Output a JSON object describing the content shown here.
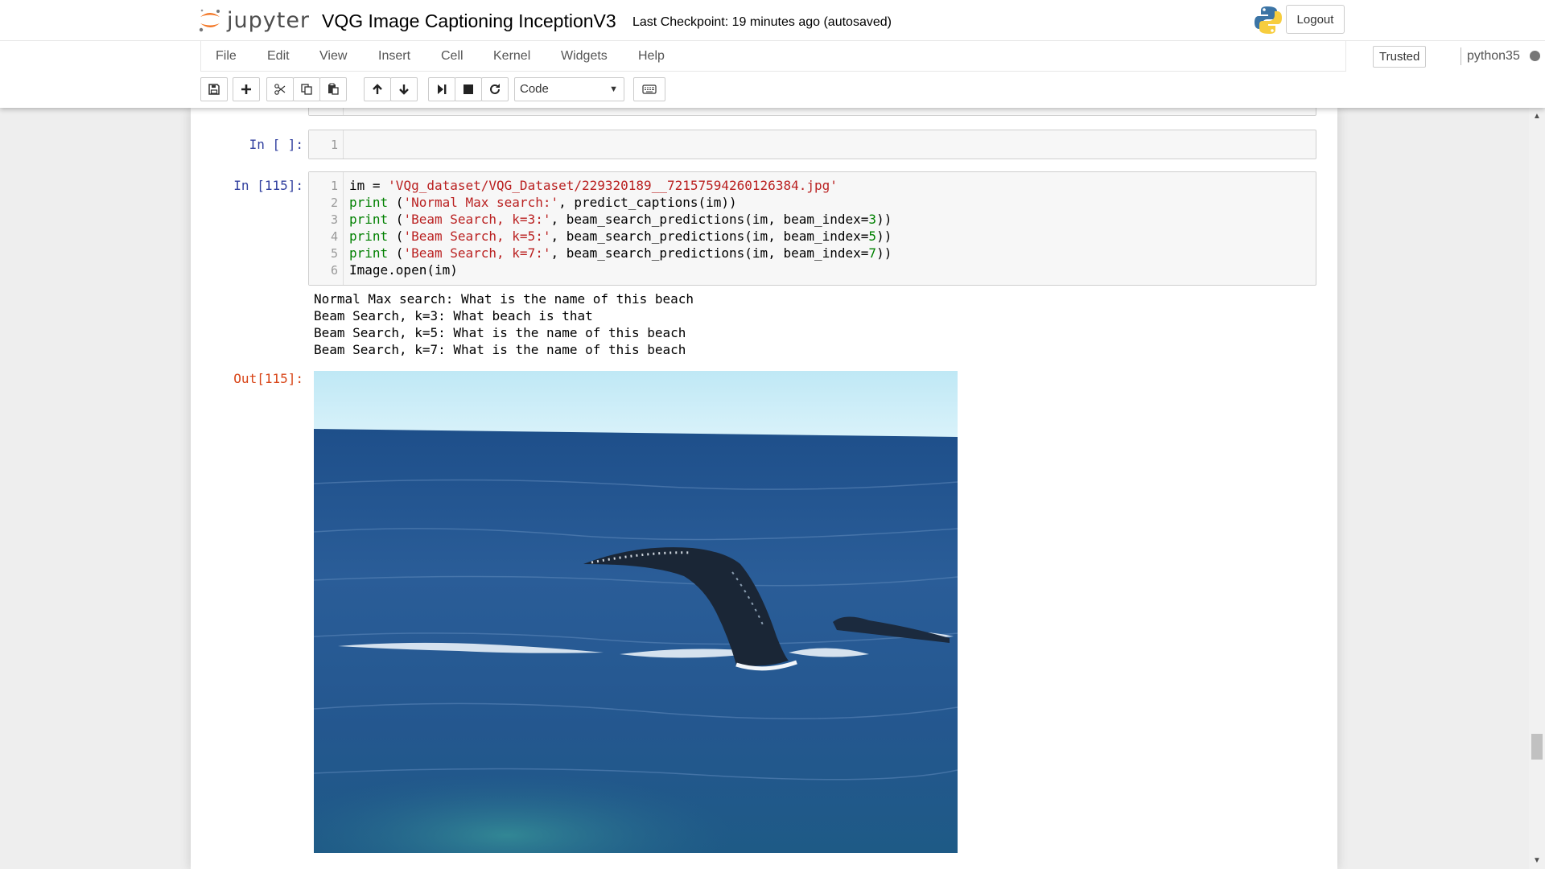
{
  "header": {
    "logo_text": "jupyter",
    "notebook_title": "VQG Image Captioning InceptionV3",
    "checkpoint": "Last Checkpoint: 19 minutes ago (autosaved)",
    "logout_label": "Logout"
  },
  "menu": {
    "items": [
      "File",
      "Edit",
      "View",
      "Insert",
      "Cell",
      "Kernel",
      "Widgets",
      "Help"
    ],
    "trusted": "Trusted",
    "kernel": "python35"
  },
  "toolbar": {
    "cell_type": "Code",
    "buttons": [
      "save-icon",
      "plus-icon",
      "cut-icon",
      "copy-icon",
      "paste-icon",
      "arrow-up-icon",
      "arrow-down-icon",
      "run-icon",
      "stop-icon",
      "restart-icon",
      "keyboard-icon"
    ]
  },
  "cells": {
    "empty_cell": {
      "prompt": "In [ ]:",
      "line_numbers": [
        "1"
      ]
    },
    "code_cell": {
      "prompt": "In [115]:",
      "out_prompt": "Out[115]:",
      "line_numbers": [
        "1",
        "2",
        "3",
        "4",
        "5",
        "6"
      ],
      "lines": [
        [
          {
            "t": "im = ",
            "c": ""
          },
          {
            "t": "'VQg_dataset/VQG_Dataset/229320189__72157594260126384.jpg'",
            "c": "st"
          }
        ],
        [
          {
            "t": "print",
            "c": "kw"
          },
          {
            "t": " (",
            "c": ""
          },
          {
            "t": "'Normal Max search:'",
            "c": "st"
          },
          {
            "t": ", predict_captions(im))",
            "c": ""
          }
        ],
        [
          {
            "t": "print",
            "c": "kw"
          },
          {
            "t": " (",
            "c": ""
          },
          {
            "t": "'Beam Search, k=3:'",
            "c": "st"
          },
          {
            "t": ", beam_search_predictions(im, beam_index=",
            "c": ""
          },
          {
            "t": "3",
            "c": "nm"
          },
          {
            "t": "))",
            "c": ""
          }
        ],
        [
          {
            "t": "print",
            "c": "kw"
          },
          {
            "t": " (",
            "c": ""
          },
          {
            "t": "'Beam Search, k=5:'",
            "c": "st"
          },
          {
            "t": ", beam_search_predictions(im, beam_index=",
            "c": ""
          },
          {
            "t": "5",
            "c": "nm"
          },
          {
            "t": "))",
            "c": ""
          }
        ],
        [
          {
            "t": "print",
            "c": "kw"
          },
          {
            "t": " (",
            "c": ""
          },
          {
            "t": "'Beam Search, k=7:'",
            "c": "st"
          },
          {
            "t": ", beam_search_predictions(im, beam_index=",
            "c": ""
          },
          {
            "t": "7",
            "c": "nm"
          },
          {
            "t": "))",
            "c": ""
          }
        ],
        [
          {
            "t": "Image.open(im)",
            "c": ""
          }
        ]
      ],
      "stdout": [
        "Normal Max search: What is the name of this beach",
        "Beam Search, k=3: What beach is that",
        "Beam Search, k=5: What is the name of this beach",
        "Beam Search, k=7: What is the name of this beach"
      ]
    }
  },
  "colors": {
    "in_prompt": "#303f9f",
    "out_prompt": "#d84315",
    "keyword": "#008000",
    "string": "#ba2121",
    "jupyter_orange": "#f37726"
  }
}
